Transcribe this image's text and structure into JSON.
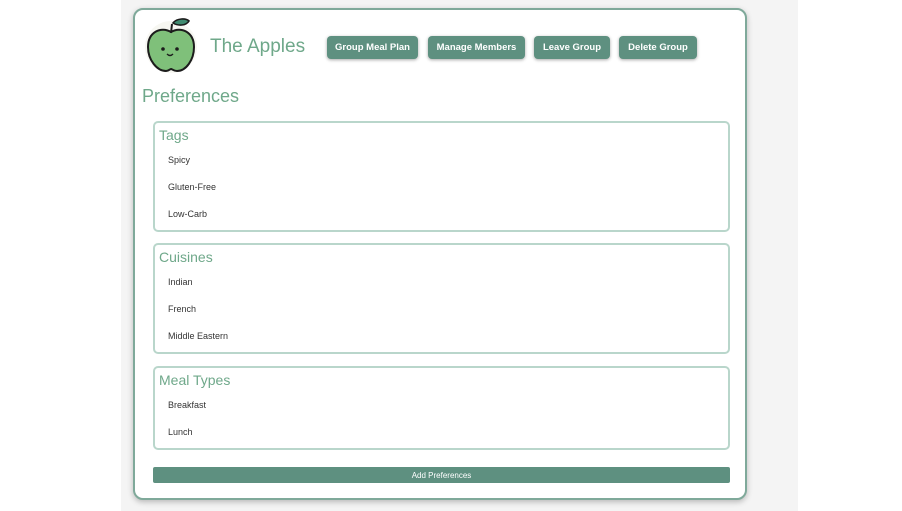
{
  "group": {
    "name": "The Apples"
  },
  "header": {
    "buttons": [
      {
        "label": "Group Meal Plan"
      },
      {
        "label": "Manage Members"
      },
      {
        "label": "Leave Group"
      },
      {
        "label": "Delete Group"
      }
    ]
  },
  "preferences": {
    "title": "Preferences",
    "sections": [
      {
        "title": "Tags",
        "items": [
          "Spicy",
          "Gluten-Free",
          "Low-Carb"
        ]
      },
      {
        "title": "Cuisines",
        "items": [
          "Indian",
          "French",
          "Middle Eastern"
        ]
      },
      {
        "title": "Meal Types",
        "items": [
          "Breakfast",
          "Lunch"
        ]
      }
    ],
    "add_label": "Add Preferences"
  },
  "colors": {
    "accent": "#5e9080",
    "title_text": "#6fa88a",
    "section_border": "#b9d6cb"
  },
  "icons": {
    "logo": "green-apple-logo"
  }
}
